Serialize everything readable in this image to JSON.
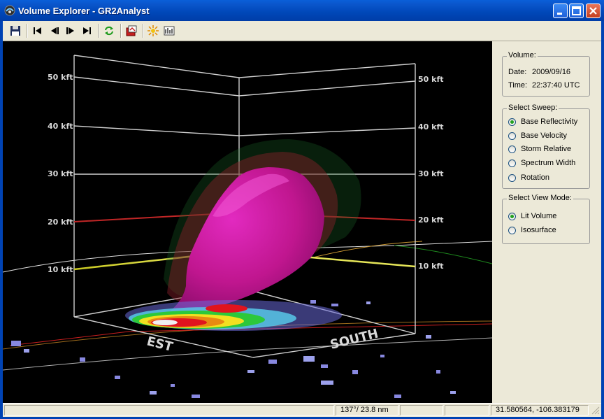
{
  "window": {
    "title": "Volume Explorer - GR2Analyst"
  },
  "toolbar": {
    "buttons": [
      "save-icon",
      "first-frame-icon",
      "step-back-icon",
      "step-forward-icon",
      "last-frame-icon",
      "refresh-icon",
      "export-icon",
      "lighting-icon",
      "options-icon"
    ]
  },
  "viewport": {
    "altitude_labels_left": [
      "50 kft",
      "40 kft",
      "30 kft",
      "20 kft",
      "10 kft"
    ],
    "altitude_labels_right": [
      "50 kft",
      "40 kft",
      "30 kft",
      "20 kft",
      "10 kft"
    ],
    "floor_labels": [
      "EST",
      "SOUTH"
    ]
  },
  "volume": {
    "legend": "Volume:",
    "date_label": "Date:",
    "date": "2009/09/16",
    "time_label": "Time:",
    "time": "22:37:40 UTC"
  },
  "sweep": {
    "legend": "Select Sweep:",
    "options": [
      "Base Reflectivity",
      "Base Velocity",
      "Storm Relative",
      "Spectrum Width",
      "Rotation"
    ],
    "selected": "Base Reflectivity"
  },
  "view_mode": {
    "legend": "Select View Mode:",
    "options": [
      "Lit Volume",
      "Isosurface"
    ],
    "selected": "Lit Volume"
  },
  "status_bar": {
    "bearing_range": "137°/ 23.8 nm",
    "coordinates": "31.580564, -106.383179"
  },
  "colors": {
    "title_bar": "#0054E3",
    "isosurface": "#C8189F",
    "background": "#000000",
    "panel": "#ECE9D8"
  }
}
